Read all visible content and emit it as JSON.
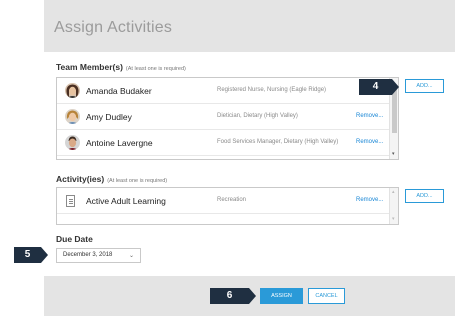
{
  "dialog": {
    "title": "Assign Activities"
  },
  "team": {
    "label": "Team Member(s)",
    "required_note": "(At least one is required)",
    "add_label": "ADD...",
    "members": [
      {
        "name": "Amanda Budaker",
        "role": "Registered Nurse, Nursing (Eagle Ridge)",
        "remove_label": ""
      },
      {
        "name": "Amy Dudley",
        "role": "Dietician, Dietary (High Valley)",
        "remove_label": "Remove..."
      },
      {
        "name": "Antoine Lavergne",
        "role": "Food Services Manager, Dietary (High Valley)",
        "remove_label": "Remove..."
      }
    ]
  },
  "activity": {
    "label": "Activity(ies)",
    "required_note": "(At least one is required)",
    "add_label": "ADD...",
    "items": [
      {
        "name": "Active Adult Learning",
        "category": "Recreation",
        "remove_label": "Remove..."
      }
    ]
  },
  "due_date": {
    "label": "Due Date",
    "value": "December 3, 2018"
  },
  "footer": {
    "assign_label": "ASSIGN",
    "cancel_label": "CANCEL"
  },
  "callouts": {
    "add": "4",
    "date": "5",
    "assign": "6"
  },
  "colors": {
    "accent": "#2a9ad8",
    "header_bg": "#e4e4e4",
    "callout_bg": "#1f2f41",
    "link": "#1a87d6"
  },
  "icons": {
    "scroll_up": "▴",
    "scroll_down": "▾",
    "dropdown": "⌄"
  }
}
